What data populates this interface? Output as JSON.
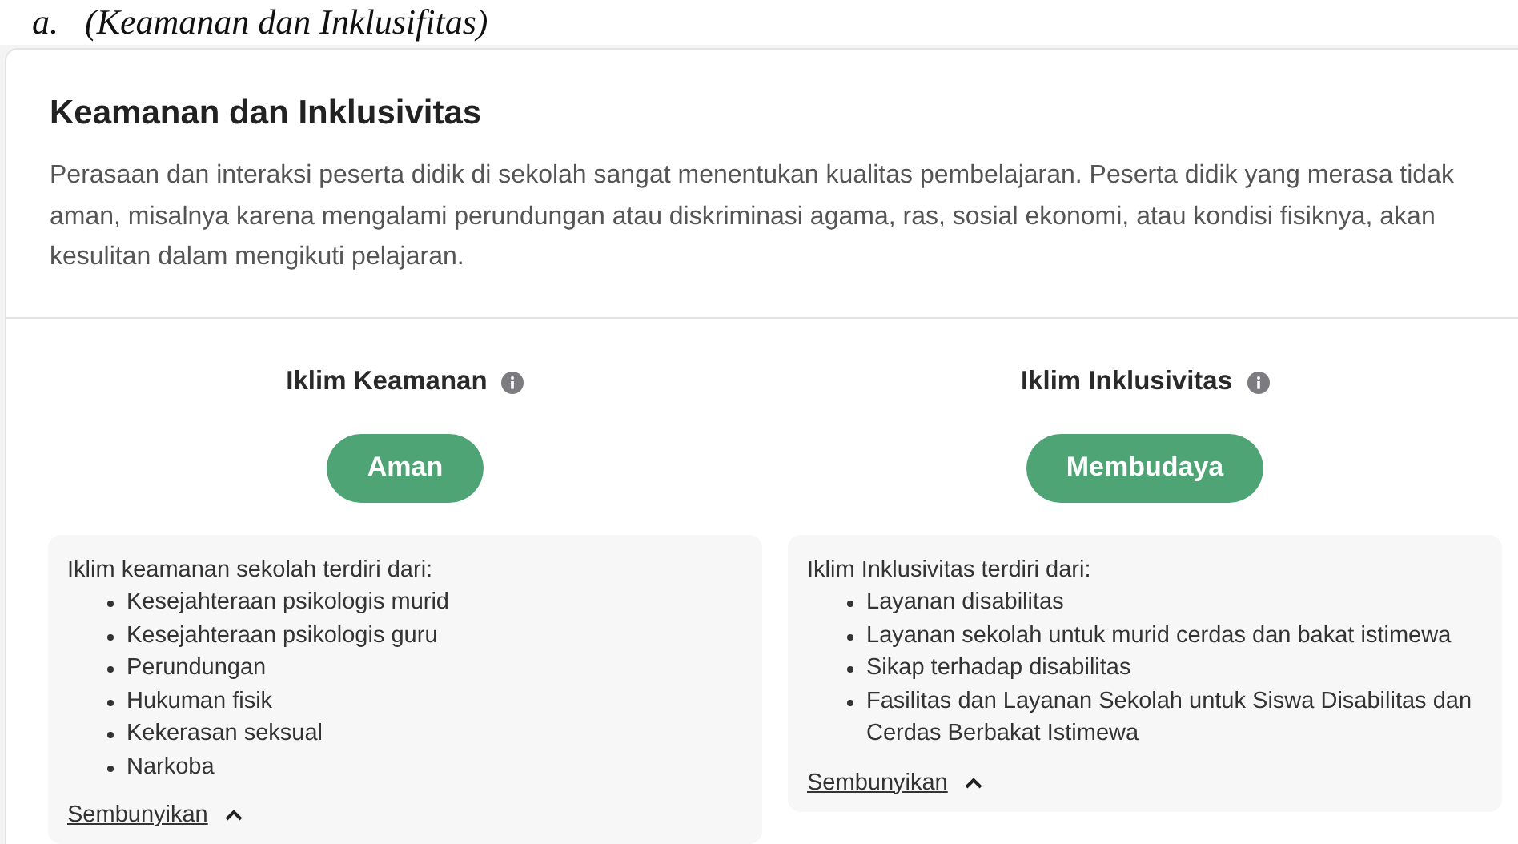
{
  "document_heading": "a.   (Keamanan dan Inklusifitas)",
  "card": {
    "title": "Keamanan dan Inklusivitas",
    "description": "Perasaan dan interaksi peserta didik di sekolah sangat menentukan kualitas pembelajaran. Peserta didik yang merasa tidak aman, misalnya karena mengalami perundungan atau diskriminasi agama, ras, sosial ekonomi, atau kondisi fisiknya, akan kesulitan dalam mengikuti pelajaran.",
    "indicators": [
      {
        "title": "Iklim Keamanan",
        "status": "Aman",
        "color": "#4ea474",
        "details_intro": "Iklim keamanan sekolah terdiri dari:",
        "expanded": true,
        "items": [
          "Kesejahteraan psikologis murid",
          "Kesejahteraan psikologis guru",
          "Perundungan",
          "Hukuman fisik",
          "Kekerasan seksual",
          "Narkoba"
        ],
        "toggle_label": "Sembunyikan"
      },
      {
        "title": "Iklim Inklusivitas",
        "status": "Membudaya",
        "color": "#4ea474",
        "details_intro": "Iklim Inklusivitas terdiri dari:",
        "expanded": true,
        "items": [
          "Layanan disabilitas",
          "Layanan sekolah untuk murid cerdas dan bakat istimewa",
          "Sikap terhadap disabilitas",
          "Fasilitas dan Layanan Sekolah untuk Siswa Disabilitas dan Cerdas Berbakat Istimewa"
        ],
        "toggle_label": "Sembunyikan"
      }
    ]
  }
}
